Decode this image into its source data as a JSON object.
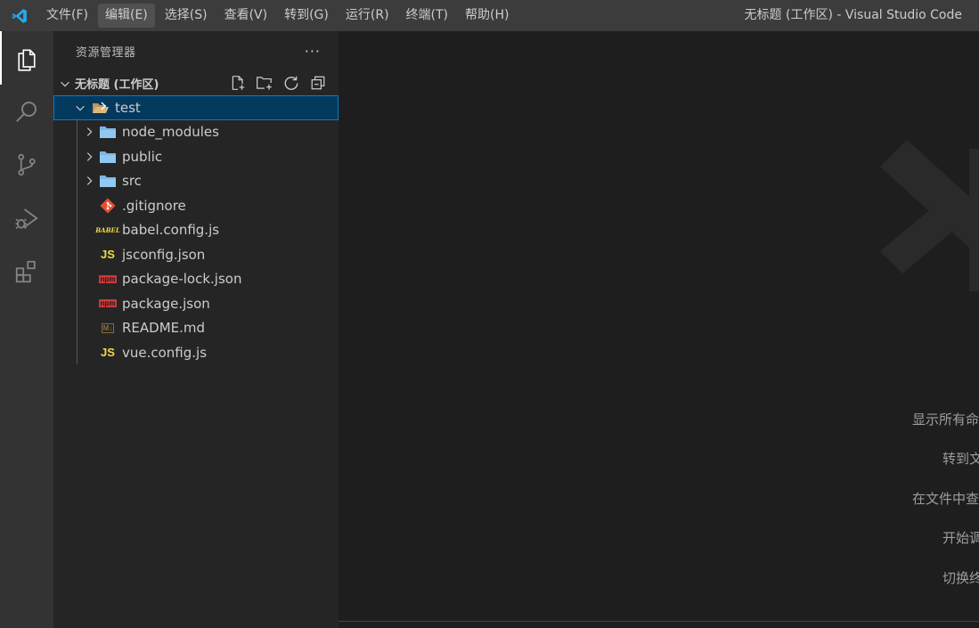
{
  "titlebar": {
    "menu": [
      {
        "label": "文件(F)"
      },
      {
        "label": "编辑(E)"
      },
      {
        "label": "选择(S)"
      },
      {
        "label": "查看(V)"
      },
      {
        "label": "转到(G)"
      },
      {
        "label": "运行(R)"
      },
      {
        "label": "终端(T)"
      },
      {
        "label": "帮助(H)"
      }
    ],
    "active_menu": "编辑(E)",
    "window_title": "无标题 (工作区) - Visual Studio Code"
  },
  "activitybar": {
    "items": [
      "explorer-icon",
      "search-icon",
      "source-control-icon",
      "run-debug-icon",
      "extensions-icon"
    ],
    "active": "explorer-icon"
  },
  "sidebar": {
    "title": "资源管理器",
    "more": "···",
    "workspace": {
      "title": "无标题 (工作区)",
      "actions": [
        "new-file-icon",
        "new-folder-icon",
        "refresh-icon",
        "collapse-all-icon"
      ]
    },
    "tree": {
      "root": {
        "name": "test",
        "expanded": true,
        "selected": true
      },
      "items": [
        {
          "name": "node_modules",
          "type": "folder",
          "icon": "folder-icon"
        },
        {
          "name": "public",
          "type": "folder",
          "icon": "folder-icon"
        },
        {
          "name": "src",
          "type": "folder",
          "icon": "folder-icon"
        },
        {
          "name": ".gitignore",
          "type": "file",
          "icon": "git-icon"
        },
        {
          "name": "babel.config.js",
          "type": "file",
          "icon": "babel-icon"
        },
        {
          "name": "jsconfig.json",
          "type": "file",
          "icon": "js-icon"
        },
        {
          "name": "package-lock.json",
          "type": "file",
          "icon": "npm-icon"
        },
        {
          "name": "package.json",
          "type": "file",
          "icon": "npm-icon"
        },
        {
          "name": "README.md",
          "type": "file",
          "icon": "markdown-icon"
        },
        {
          "name": "vue.config.js",
          "type": "file",
          "icon": "js-icon"
        }
      ]
    }
  },
  "icon_text": {
    "js": "JS",
    "babel": "BABEL",
    "npm": "npm",
    "markdown": "M↓"
  },
  "editor": {
    "hints": [
      "显示所有命",
      "转到文",
      "在文件中查",
      "开始调",
      "切换终"
    ]
  },
  "colors": {
    "accent": "#007fd4",
    "selection": "#04395e",
    "folder": "#7ab7e8",
    "js": "#f1d945",
    "npm": "#cb3837",
    "git": "#e84d31",
    "vscode_blue": "#23a9f2"
  }
}
